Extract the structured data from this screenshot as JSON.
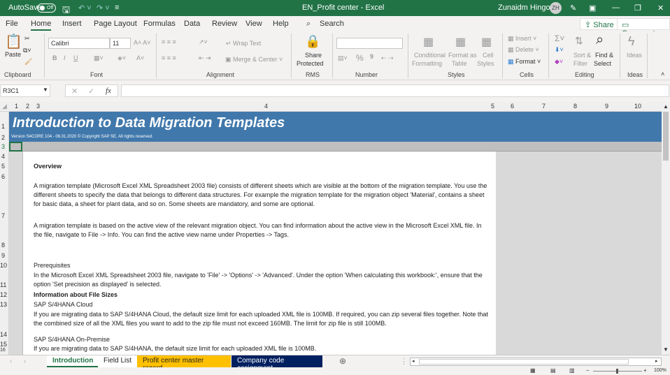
{
  "titlebar": {
    "autosave": "AutoSave",
    "autosave_state": "Off",
    "title": "EN_Profit center  -  Excel",
    "user": "Zunaidm Hingora",
    "initials": "ZH"
  },
  "menu": {
    "items": [
      "File",
      "Home",
      "Insert",
      "Page Layout",
      "Formulas",
      "Data",
      "Review",
      "View",
      "Help"
    ],
    "active": "Home",
    "search": "Search",
    "share": "Share",
    "comments": "Comments"
  },
  "ribbon": {
    "clipboard": {
      "label": "Clipboard",
      "paste": "Paste"
    },
    "font": {
      "label": "Font",
      "name": "Calibri",
      "size": "11",
      "bold": "B",
      "italic": "I",
      "underline": "U"
    },
    "alignment": {
      "label": "Alignment",
      "wrap": "Wrap Text",
      "merge": "Merge & Center"
    },
    "rms": {
      "label": "RMS",
      "share_protected": "Share",
      "share_protected2": "Protected"
    },
    "number": {
      "label": "Number",
      "format": "",
      "percent": "%",
      "comma": "9"
    },
    "styles": {
      "label": "Styles",
      "conditional": "Conditional",
      "conditional2": "Formatting",
      "format_table": "Format as",
      "format_table2": "Table",
      "cell_styles": "Cell",
      "cell_styles2": "Styles"
    },
    "cells": {
      "label": "Cells",
      "insert": "Insert",
      "delete": "Delete",
      "format": "Format"
    },
    "editing": {
      "label": "Editing",
      "sort": "Sort &",
      "sort2": "Filter",
      "find": "Find &",
      "find2": "Select"
    },
    "ideas": {
      "label": "Ideas",
      "ideas": "Ideas"
    }
  },
  "formula_bar": {
    "name_box": "R3C1",
    "fx": "fx",
    "value": ""
  },
  "columns": [
    "1",
    "2",
    "3",
    "4",
    "5",
    "6",
    "7",
    "8",
    "9",
    "10"
  ],
  "rows": [
    "1",
    "2",
    "3",
    "4",
    "5",
    "6",
    "7",
    "8",
    "9",
    "10",
    "11",
    "12",
    "13",
    "14",
    "15",
    "16"
  ],
  "sheet": {
    "title": "Introduction to Data Migration Templates",
    "version": "Version S4CORE 104  - 06.01.2020 © Copyright SAP SE. All rights reserved.",
    "overview": "Overview",
    "p1": "A migration template (Microsoft Excel XML Spreadsheet 2003 file) consists of different sheets which are visible at the bottom of the migration template. You use the different sheets to specify the data that belongs to different data structures. For example the migration template for the migration object 'Material', contains a sheet for basic data, a sheet for plant data, and so on. Some sheets are mandatory, and some are optional.",
    "p2": "A migration template is based on the active view of the relevant migration object. You can find information about the active view in the Microsoft Excel XML file. In the file, navigate to File -> Info. You can find the active view name under Properties -> Tags.",
    "prereq": "Prerequisites",
    "p3": "In the Microsoft Excel XML Spreadsheet 2003 file, navigate to 'File' -> 'Options' -> 'Advanced'. Under the option 'When calculating this workbook:', ensure that the option 'Set precision as displayed' is selected.",
    "filesizes": "Information about File Sizes",
    "cloud": "SAP S/4HANA Cloud",
    "p4": "If you are migrating data to SAP S/4HANA Cloud, the default size limit for each uploaded XML file is 100MB.  If required, you can zip several files together. Note that the combined size of all the XML files you want to add to the zip file must not exceed 160MB.  The limit for zip file is still 100MB.",
    "onprem": "SAP S/4HANA On-Premise",
    "p5": "If you are migrating data to SAP S/4HANA, the default size limit for each uploaded XML file is 100MB."
  },
  "tabs": [
    {
      "label": "Introduction",
      "active": true
    },
    {
      "label": "Field List"
    },
    {
      "label": "Profit center master record",
      "color": "#ffc000"
    },
    {
      "label": "Company code assignment",
      "color": "#002060"
    }
  ],
  "status": {
    "zoom": "100%"
  },
  "colors": {
    "excel_green": "#217346",
    "banner_blue": "#4178ac"
  }
}
